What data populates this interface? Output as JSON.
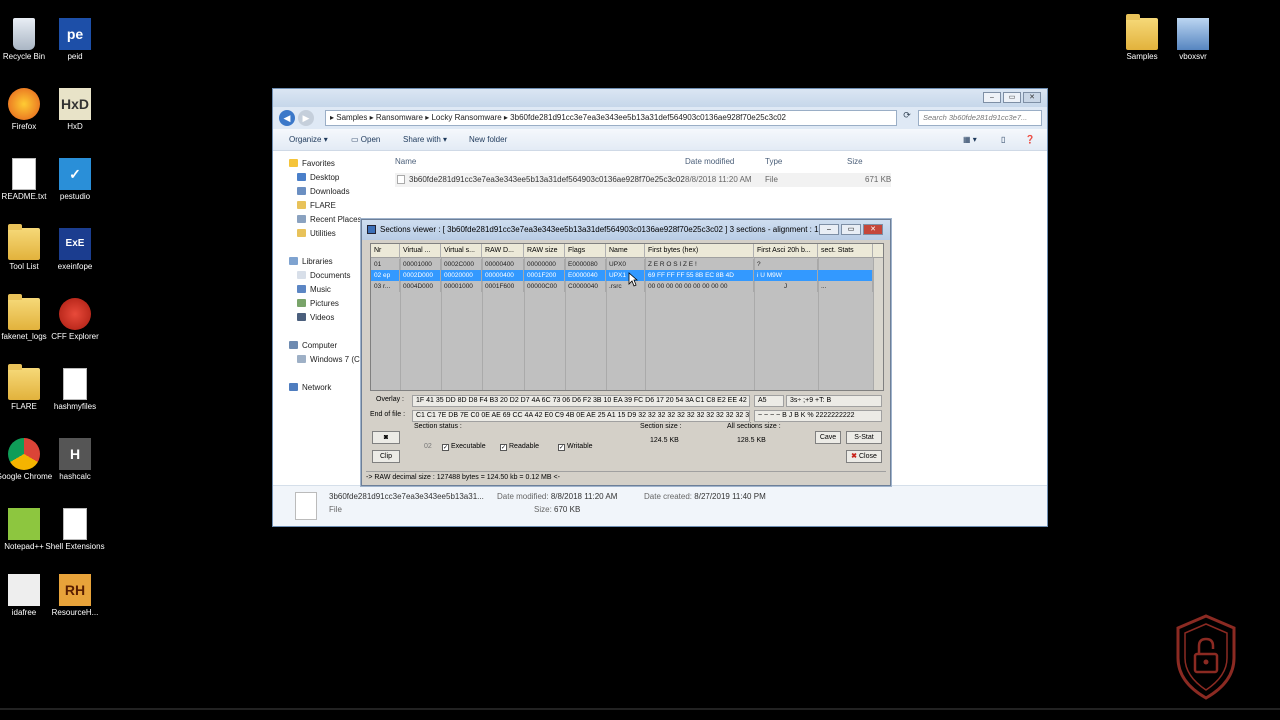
{
  "desktop": {
    "left_icons": [
      {
        "label": "Recycle Bin",
        "icon": "recycle-bin-icon"
      },
      {
        "label": "peid",
        "icon": "peid-icon"
      },
      {
        "label": "Firefox",
        "icon": "firefox-icon"
      },
      {
        "label": "HxD",
        "icon": "hxd-icon"
      },
      {
        "label": "README.txt",
        "icon": "text-file-icon"
      },
      {
        "label": "pestudio",
        "icon": "pestudio-icon"
      },
      {
        "label": "Tool List",
        "icon": "folder-icon"
      },
      {
        "label": "exeinfope",
        "icon": "exeinfope-icon"
      },
      {
        "label": "fakenet_logs",
        "icon": "folder-icon"
      },
      {
        "label": "CFF Explorer",
        "icon": "cff-explorer-icon"
      },
      {
        "label": "FLARE",
        "icon": "folder-icon"
      },
      {
        "label": "hashmyfiles",
        "icon": "hashmyfiles-icon"
      },
      {
        "label": "Google Chrome",
        "icon": "chrome-icon"
      },
      {
        "label": "hashcalc",
        "icon": "hashcalc-icon"
      },
      {
        "label": "Notepad++",
        "icon": "notepadpp-icon"
      },
      {
        "label": "Shell Extensions",
        "icon": "shell-extensions-icon"
      },
      {
        "label": "idafree",
        "icon": "idafree-icon"
      },
      {
        "label": "ResourceH...",
        "icon": "resource-hacker-icon"
      }
    ],
    "right_icons": [
      {
        "label": "Samples",
        "icon": "folder-icon"
      },
      {
        "label": "vboxsvr",
        "icon": "network-drive-icon"
      }
    ]
  },
  "explorer": {
    "breadcrumb": [
      "Samples",
      "Ransomware",
      "Locky Ransomware",
      "3b60fde281d91cc3e7ea3e343ee5b13a31def564903c0136ae928f70e25c3c02"
    ],
    "search_placeholder": "Search 3b60fde281d91cc3e7...",
    "toolbar": {
      "organize": "Organize",
      "open": "Open",
      "share": "Share with",
      "new_folder": "New folder"
    },
    "nav": {
      "favorites": "Favorites",
      "favorites_items": [
        "Desktop",
        "Downloads",
        "FLARE",
        "Recent Places",
        "Utilities"
      ],
      "libraries": "Libraries",
      "libraries_items": [
        "Documents",
        "Music",
        "Pictures",
        "Videos"
      ],
      "computer": "Computer",
      "computer_items": [
        "Windows 7 (C"
      ],
      "network": "Network"
    },
    "columns": {
      "name": "Name",
      "date": "Date modified",
      "type": "Type",
      "size": "Size"
    },
    "file": {
      "name": "3b60fde281d91cc3e7ea3e343ee5b13a31def564903c0136ae928f70e25c3c02",
      "date": "8/8/2018 11:20 AM",
      "type": "File",
      "size": "671 KB"
    },
    "details": {
      "name": "3b60fde281d91cc3e7ea3e343ee5b13a31...",
      "type": "File",
      "modified_label": "Date modified:",
      "modified": "8/8/2018 11:20 AM",
      "created_label": "Date created:",
      "created": "8/27/2019 11:40 PM",
      "size_label": "Size:",
      "size": "670 KB"
    }
  },
  "sections_viewer": {
    "title": "Sections viewer : [ 3b60fde281d91cc3e7ea3e343ee5b13a31def564903c0136ae928f70e25c3c02 ] 3 sections - alignment : 1000h",
    "headers": [
      "Nr",
      "Virtual ...",
      "Virtual s...",
      "RAW D...",
      "RAW size",
      "Flags",
      "Name",
      "First bytes (hex)",
      "First Asci 20h b...",
      "sect. Stats"
    ],
    "rows": [
      [
        "01",
        "00001000",
        "0002C000",
        "00000400",
        "00000000",
        "E0000080",
        "UPX0",
        "",
        "Z E R O   S I Z E !",
        "?",
        ""
      ],
      [
        "02 ep",
        "0002D000",
        "00020000",
        "00000400",
        "0001F200",
        "E0000040",
        "UPX1",
        "69 FF FF FF 55 8B EC 8B 4D",
        "i   U   M9W",
        "",
        ""
      ],
      [
        "03 r...",
        "0004D000",
        "00001000",
        "0001F600",
        "00000C00",
        "C0000040",
        ".rsrc",
        "00 00 00 00 00 00 00 00 00",
        "J",
        ""
      ]
    ],
    "overlay_label": "Overlay :",
    "overlay_hex": "1F 41 35 DD 8D D8 F4 B3 20 D2 D7 4A 6C 73 06 D6 F2 3B 10 EA 39 FC D6 17 20 54 3A C1 C8 E2 EE 42",
    "overlay_ascii": "A5",
    "overlay_ascii2": "3s÷ ;+9 +T: B",
    "eof_label": "End of file :",
    "eof_hex": "C1 C1 7E DB 7E C0 0E AE 69 CC 4A 42 E0 C9 4B 0E AE 25 A1 15 D9 32 32 32 32 32 32 32 32 32 32 32 32",
    "eof_ascii": "~ ~ ~ ~ B J B K % 2222222222",
    "section_status_label": "Section status :",
    "status_code": "02",
    "executable": "Executable",
    "readable": "Readable",
    "writable": "Writable",
    "section_size_label": "Section size :",
    "section_size": "124.5 KB",
    "all_sections_label": "All sections size :",
    "all_sections_size": "128.5 KB",
    "btn_clip": "Clip",
    "btn_cave": "Cave",
    "btn_sstat": "S-Stat",
    "btn_close": "Close",
    "raw_line": "->  RAW decimal size :     127488 bytes  =  124.50 kb   = 0.12 MB <-"
  }
}
